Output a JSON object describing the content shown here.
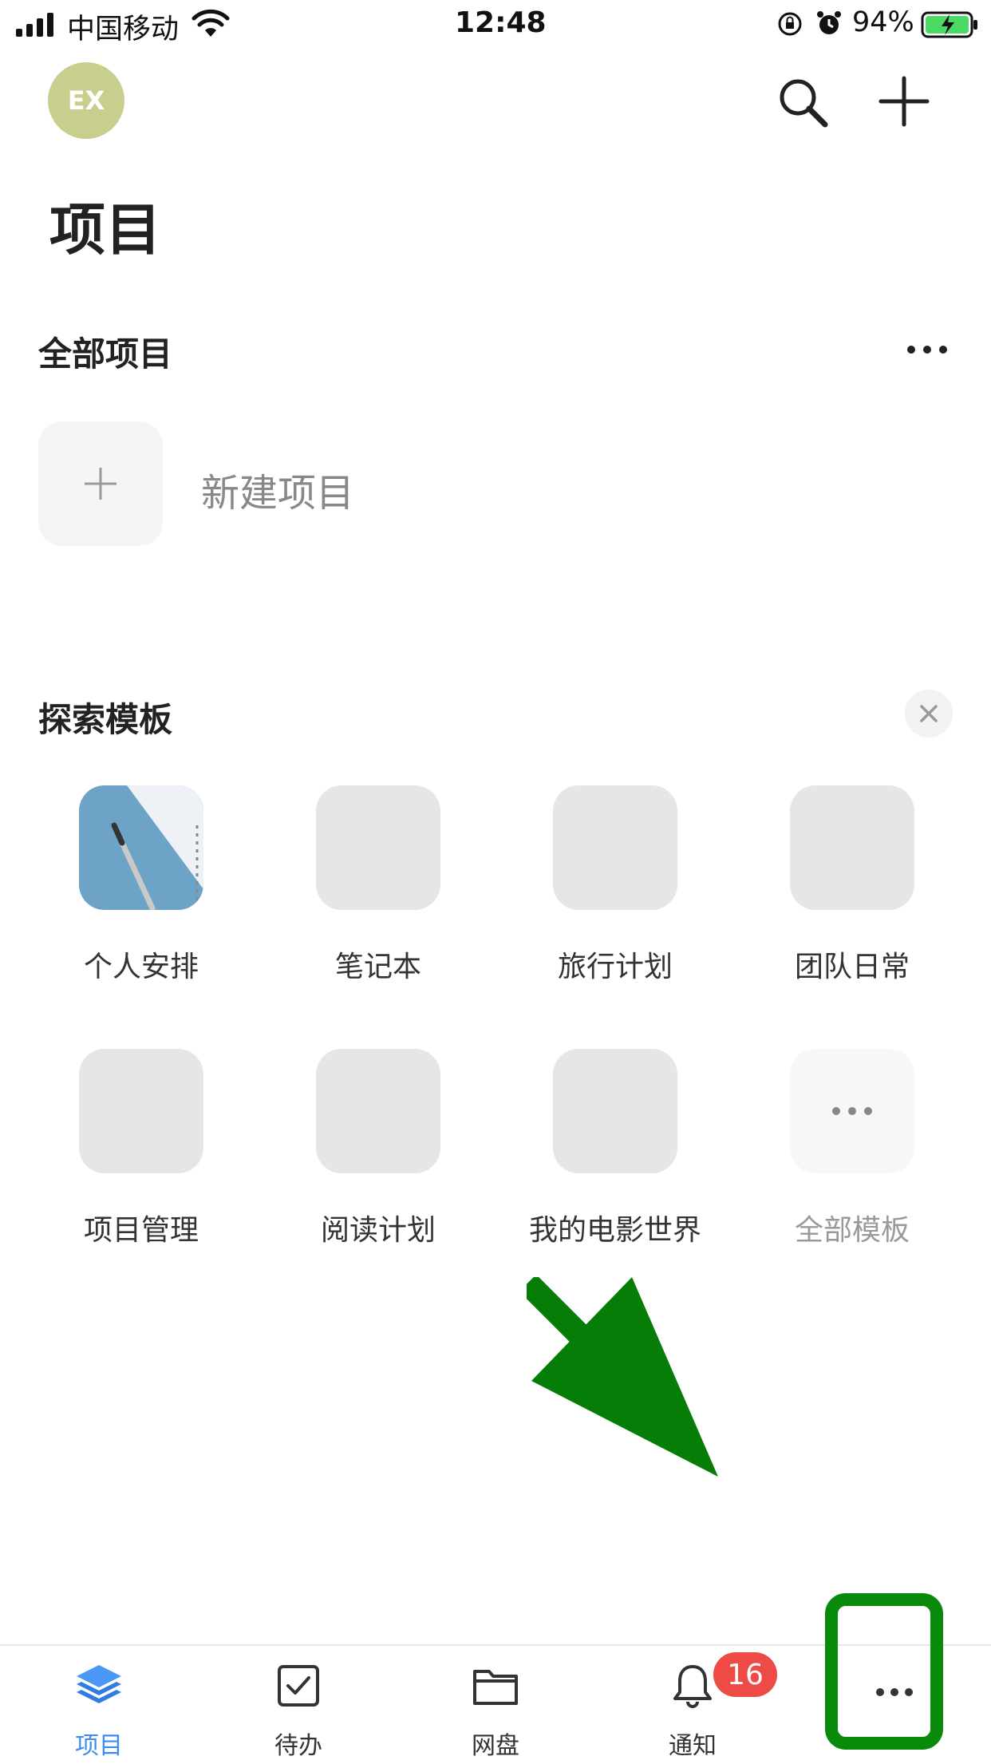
{
  "status_bar": {
    "carrier": "中国移动",
    "time": "12:48",
    "battery": "94%"
  },
  "header": {
    "avatar_initials": "EX",
    "title": "项目"
  },
  "projects_section": {
    "title": "全部项目",
    "new_project_label": "新建项目"
  },
  "templates_section": {
    "title": "探索模板",
    "items": [
      {
        "label": "个人安排"
      },
      {
        "label": "笔记本"
      },
      {
        "label": "旅行计划"
      },
      {
        "label": "团队日常"
      },
      {
        "label": "项目管理"
      },
      {
        "label": "阅读计划"
      },
      {
        "label": "我的电影世界"
      },
      {
        "label": "全部模板"
      }
    ]
  },
  "tab_bar": {
    "items": [
      {
        "label": "项目"
      },
      {
        "label": "待办"
      },
      {
        "label": "网盘"
      },
      {
        "label": "通知"
      }
    ],
    "notification_badge": "16"
  },
  "colors": {
    "accent": "#3d8bf2",
    "badge": "#ee4b47",
    "annotation_green": "#0a8a0a",
    "avatar": "#c8cf8e"
  }
}
